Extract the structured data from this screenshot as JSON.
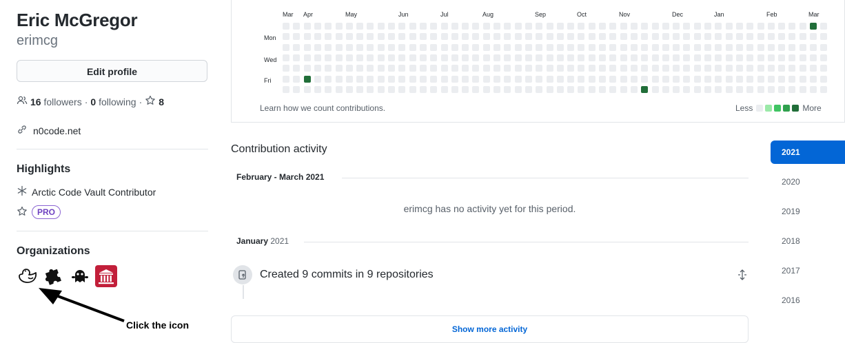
{
  "profile": {
    "name": "Eric McGregor",
    "login": "erimcg",
    "edit_label": "Edit profile",
    "followers_count": "16",
    "followers_label": "followers",
    "following_count": "0",
    "following_label": "following",
    "stars_count": "8",
    "link": "n0code.net"
  },
  "highlights": {
    "title": "Highlights",
    "arctic": "Arctic Code Vault Contributor",
    "pro": "PRO"
  },
  "organizations": {
    "title": "Organizations",
    "items": [
      "duck-org-icon",
      "puzzle-org-icon",
      "ghost-org-icon",
      "building-org-icon"
    ]
  },
  "annotation": {
    "caption": "Click the icon"
  },
  "graph": {
    "months": [
      "Mar",
      "Apr",
      "May",
      "Jun",
      "Jul",
      "Aug",
      "Sep",
      "Oct",
      "Nov",
      "Dec",
      "Jan",
      "Feb",
      "Mar"
    ],
    "days": [
      "Mon",
      "Wed",
      "Fri"
    ],
    "learn": "Learn how we count contributions.",
    "less": "Less",
    "more": "More",
    "colors": [
      "#ebedf0",
      "#9be9a8",
      "#40c463",
      "#30a14e",
      "#216e39"
    ],
    "active_cells": [
      {
        "week": 2,
        "day": 5,
        "level": 4
      },
      {
        "week": 34,
        "day": 6,
        "level": 4
      },
      {
        "week": 50,
        "day": 0,
        "level": 4
      }
    ]
  },
  "activity": {
    "title": "Contribution activity",
    "period1_label": "February - March 2021",
    "no_activity": "erimcg has no activity yet for this period.",
    "period2_month": "January",
    "period2_year": "2021",
    "commits": "Created 9 commits in 9 repositories",
    "show_more": "Show more activity"
  },
  "years": [
    "2021",
    "2020",
    "2019",
    "2018",
    "2017",
    "2016"
  ]
}
